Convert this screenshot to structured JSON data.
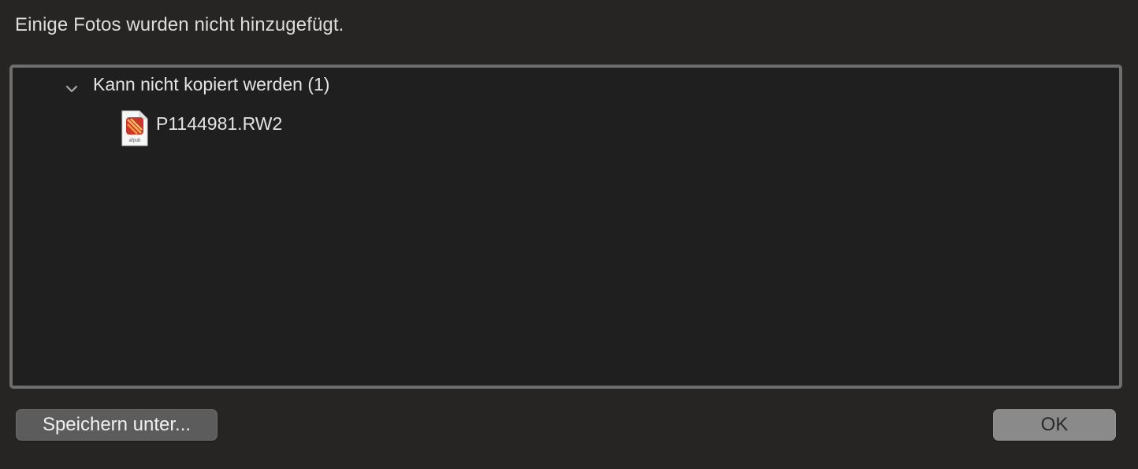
{
  "dialog": {
    "message": "Einige Fotos wurden nicht hinzugefügt."
  },
  "list": {
    "groups": [
      {
        "label": "Kann nicht kopiert werden (1)",
        "expanded": true,
        "items": [
          {
            "filename": "P1144981.RW2",
            "icon": "afpub-document-icon",
            "icon_caption": "afpub"
          }
        ]
      }
    ]
  },
  "buttons": {
    "save_as": "Speichern unter...",
    "ok": "OK"
  },
  "colors": {
    "background": "#262524",
    "list_background": "#1f1f1f",
    "list_border": "#6e6e6e",
    "ok_button": "#8a8a8a",
    "save_button": "#5c5c5c",
    "icon_accent_red": "#d8432f",
    "icon_accent_orange": "#f29a3a"
  }
}
